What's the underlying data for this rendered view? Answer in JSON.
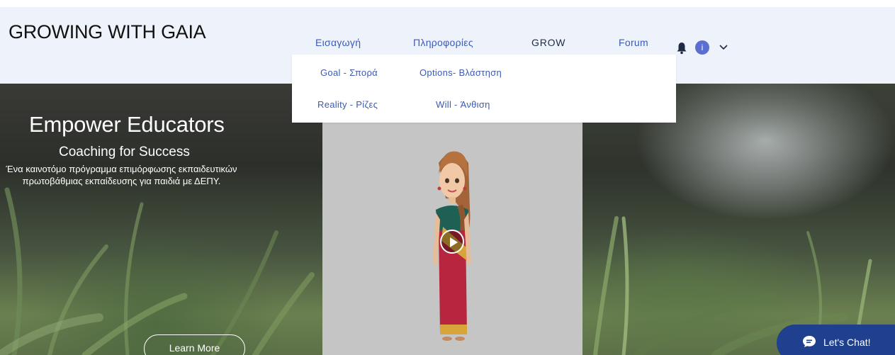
{
  "header": {
    "site_title": "GROWING WITH GAIA",
    "nav": [
      {
        "label": "Εισαγωγή"
      },
      {
        "label": "Πληροφορίες"
      },
      {
        "label": "GROW"
      },
      {
        "label": "Forum"
      }
    ],
    "avatar_letter": "i",
    "icons": [
      "bell-icon",
      "avatar",
      "chevron-down-icon"
    ]
  },
  "dropdown": {
    "items": [
      {
        "label": "Goal - Σπορά"
      },
      {
        "label": "Options- Βλάστηση"
      },
      {
        "label": "Reality - Ρίζες"
      },
      {
        "label": "Will - Άνθιση"
      }
    ]
  },
  "hero": {
    "title": "Empower Educators",
    "subtitle": "Coaching for Success",
    "description": "Ένα καινοτόμο πρόγραμμα επιμόρφωσης εκπαιδευτικών πρωτοβάθμιας εκπαίδευσης για παιδιά με ΔΕΠΥ.",
    "learn_more": "Learn More"
  },
  "chat": {
    "label": "Let's Chat!"
  },
  "colors": {
    "header_bg": "#eef2fa",
    "link": "#3b5bb5",
    "chat_bg": "#1f3f8f",
    "avatar_bg": "#5a6fd0"
  }
}
